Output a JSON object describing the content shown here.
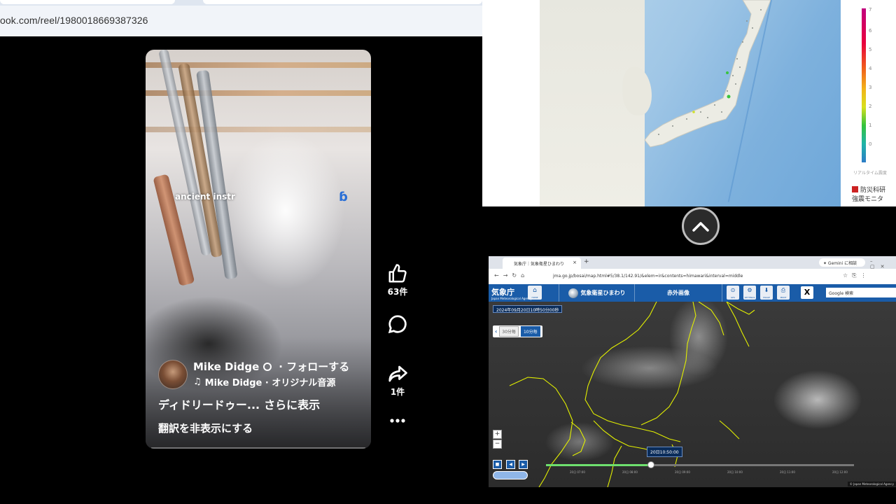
{
  "reel_browser": {
    "url": "ook.com/reel/1980018669387326"
  },
  "reel": {
    "overlay_text": "ancient instr",
    "author_name": "Mike Didge",
    "follow_label": "· フォローする",
    "audio_label": "Mike Didge · オリジナル音源",
    "description": "ディドリードゥー...",
    "see_more": "さらに表示",
    "translate_toggle": "翻訳を非表示にする",
    "likes_count": "63件",
    "shares_count": "1件",
    "icons": {
      "like": "thumbs-up-icon",
      "comment": "comment-bubble-icon",
      "share": "share-arrow-icon",
      "more": "more-dots-icon",
      "audio": "music-note-icon",
      "privacy": "globe-icon"
    }
  },
  "seismic_panel": {
    "scale_values": [
      "7",
      "6",
      "5",
      "4",
      "3",
      "2",
      "1",
      "0"
    ],
    "scale_caption": "リアルタイム震度",
    "logo_line1": "防災科研",
    "logo_line2": "強震モニタ"
  },
  "collapse_button": {
    "icon": "chevron-up-icon"
  },
  "jma": {
    "tab_title": "気象庁｜気象衛星ひまわり",
    "tab_close": "×",
    "new_tab": "+",
    "gemini_label": "✦ Gemini に相談",
    "url": "jma.go.jp/bosai/map.html#5/38.1/142.91/&elem=ir&contents=himawari&interval=middle",
    "logo_text": "気象庁",
    "logo_sub": "Japan Meteorological Agency",
    "home_label": "HOME",
    "menu_satellite": "気象衛星ひまわり",
    "menu_image_type": "赤外画像",
    "tool_labels": [
      "GPS",
      "SETTINGS",
      "IMAGE",
      "PRINT",
      "HELP"
    ],
    "x_label": "X",
    "search_placeholder": "Google 検索",
    "timestamp": "2024年09月20日10時50分00秒",
    "interval_options": [
      "30分毎",
      "10分毎"
    ],
    "zoom_in": "+",
    "zoom_out": "−",
    "current_time": "20日10:50:00",
    "timeline_progress": 0.34,
    "tick_labels": [
      "20日\n07:00",
      "20日\n08:00",
      "20日\n09:00",
      "20日\n10:00",
      "20日\n11:00",
      "20日\n12:00"
    ],
    "credit": "© Japan Meteorological Agency"
  }
}
